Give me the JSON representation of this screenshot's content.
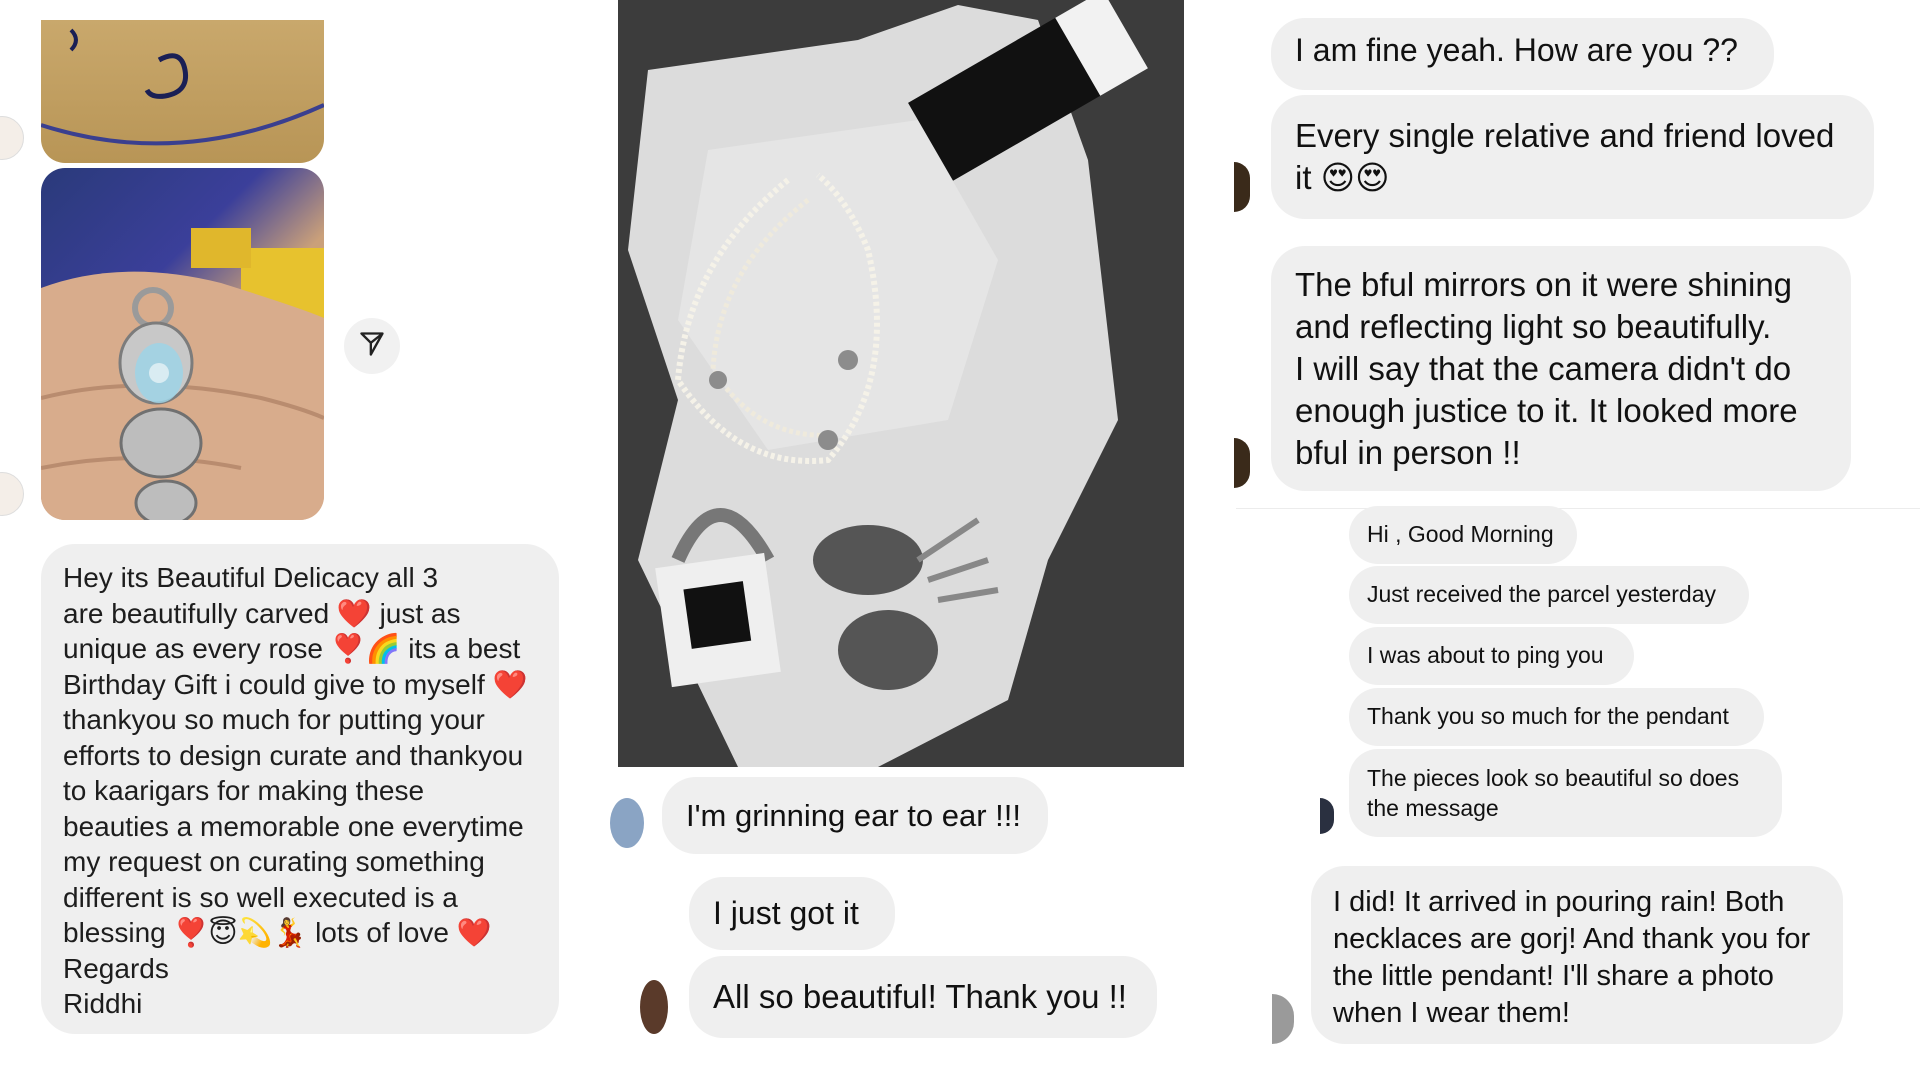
{
  "column1": {
    "top_image_alt": "gift box with handwritten message",
    "hand_image_alt": "hand holding peacock silver earrings",
    "send_icon": "paper-plane-icon",
    "message": "Hey its Beautiful Delicacy all 3\nare beautifully carved ❤️ just as\nunique as every rose ❣️🌈 its a best\nBirthday Gift i could give to myself ❤️\nthankyou so much for putting your\nefforts to design curate and thankyou\nto kaarigars for making these\nbeauties a memorable one everytime\nmy request on curating something\ndifferent is so well executed is a\nblessing ❣️😇💫💃 lots of love ❤️\nRegards\nRiddhi"
  },
  "column2": {
    "photo_alt": "pearl necklace and silver jewellery on tissue paper",
    "messages": [
      "I'm grinning ear to ear !!!",
      "I just got it",
      "All so beautiful! Thank you !!"
    ]
  },
  "column3": {
    "messages": [
      "I am fine yeah. How are you ??",
      "Every single relative and friend loved\nit 😍😍",
      "The bful mirrors on it were shining\nand reflecting light so beautifully.\nI will say that the camera didn't do\nenough justice to it. It looked more\nbful in person !!"
    ],
    "small_messages": [
      "Hi , Good Morning",
      "Just received the parcel yesterday",
      "I was about to ping you",
      "Thank you so much for the pendant",
      "The pieces look so beautiful so does\nthe message"
    ],
    "last_message": "I did! It arrived in pouring rain! Both\nnecklaces are gorj! And thank you for\nthe little pendant! I'll share a photo\nwhen I wear them!"
  }
}
